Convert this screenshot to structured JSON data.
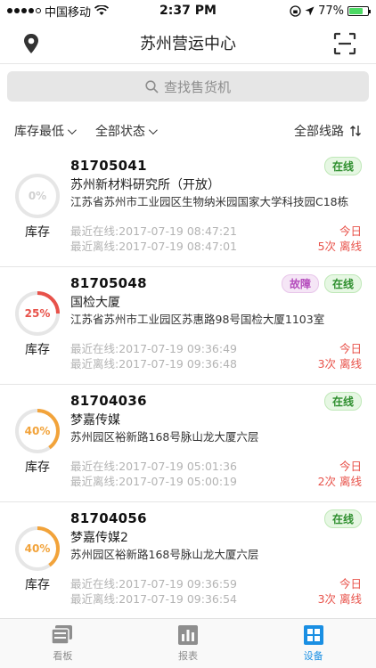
{
  "status_bar": {
    "carrier": "中国移动",
    "time": "2:37 PM",
    "battery": "77%",
    "battery_level": 0.77
  },
  "nav": {
    "title": "苏州营运中心",
    "left_icon": "location-pin-icon",
    "right_icon": "scan-icon"
  },
  "search": {
    "placeholder": "查找售货机"
  },
  "filters": {
    "sort": "库存最低",
    "status": "全部状态",
    "route": "全部线路"
  },
  "devices": [
    {
      "id": "81705041",
      "name": "苏州新材料研究所（开放）",
      "address": "江苏省苏州市工业园区生物纳米园国家大学科技园C18栋",
      "stock_percent": "0%",
      "stock_value": 0,
      "stock_label": "库存",
      "badges": [
        {
          "text": "在线",
          "type": "online"
        }
      ],
      "last_online": "最近在线:2017-07-19 08:47:21",
      "last_offline": "最近离线:2017-07-19 08:47:01",
      "today": "今日",
      "offline_count": "5次 离线"
    },
    {
      "id": "81705048",
      "name": "国检大厦",
      "address": "江苏省苏州市工业园区苏惠路98号国检大厦1103室",
      "stock_percent": "25%",
      "stock_value": 25,
      "stock_label": "库存",
      "badges": [
        {
          "text": "故障",
          "type": "fault"
        },
        {
          "text": "在线",
          "type": "online"
        }
      ],
      "last_online": "最近在线:2017-07-19 09:36:49",
      "last_offline": "最近离线:2017-07-19 09:36:48",
      "today": "今日",
      "offline_count": "3次 离线"
    },
    {
      "id": "81704036",
      "name": "梦嘉传媒",
      "address": "苏州园区裕新路168号脉山龙大厦六层",
      "stock_percent": "40%",
      "stock_value": 40,
      "stock_label": "库存",
      "badges": [
        {
          "text": "在线",
          "type": "online"
        }
      ],
      "last_online": "最近在线:2017-07-19 05:01:36",
      "last_offline": "最近离线:2017-07-19 05:00:19",
      "today": "今日",
      "offline_count": "2次 离线"
    },
    {
      "id": "81704056",
      "name": "梦嘉传媒2",
      "address": "苏州园区裕新路168号脉山龙大厦六层",
      "stock_percent": "40%",
      "stock_value": 40,
      "stock_label": "库存",
      "badges": [
        {
          "text": "在线",
          "type": "online"
        }
      ],
      "last_online": "最近在线:2017-07-19 09:36:59",
      "last_offline": "最近离线:2017-07-19 09:36:54",
      "today": "今日",
      "offline_count": "3次 离线"
    }
  ],
  "tabs": [
    {
      "label": "看板",
      "icon": "dashboard-icon",
      "active": false
    },
    {
      "label": "报表",
      "icon": "report-icon",
      "active": false
    },
    {
      "label": "设备",
      "icon": "device-icon",
      "active": true
    }
  ],
  "colors": {
    "accent": "#1a8fe3",
    "danger": "#e8524a",
    "warning": "#f2a33a",
    "online": "#2f8f2f",
    "fault": "#b54dbd"
  }
}
